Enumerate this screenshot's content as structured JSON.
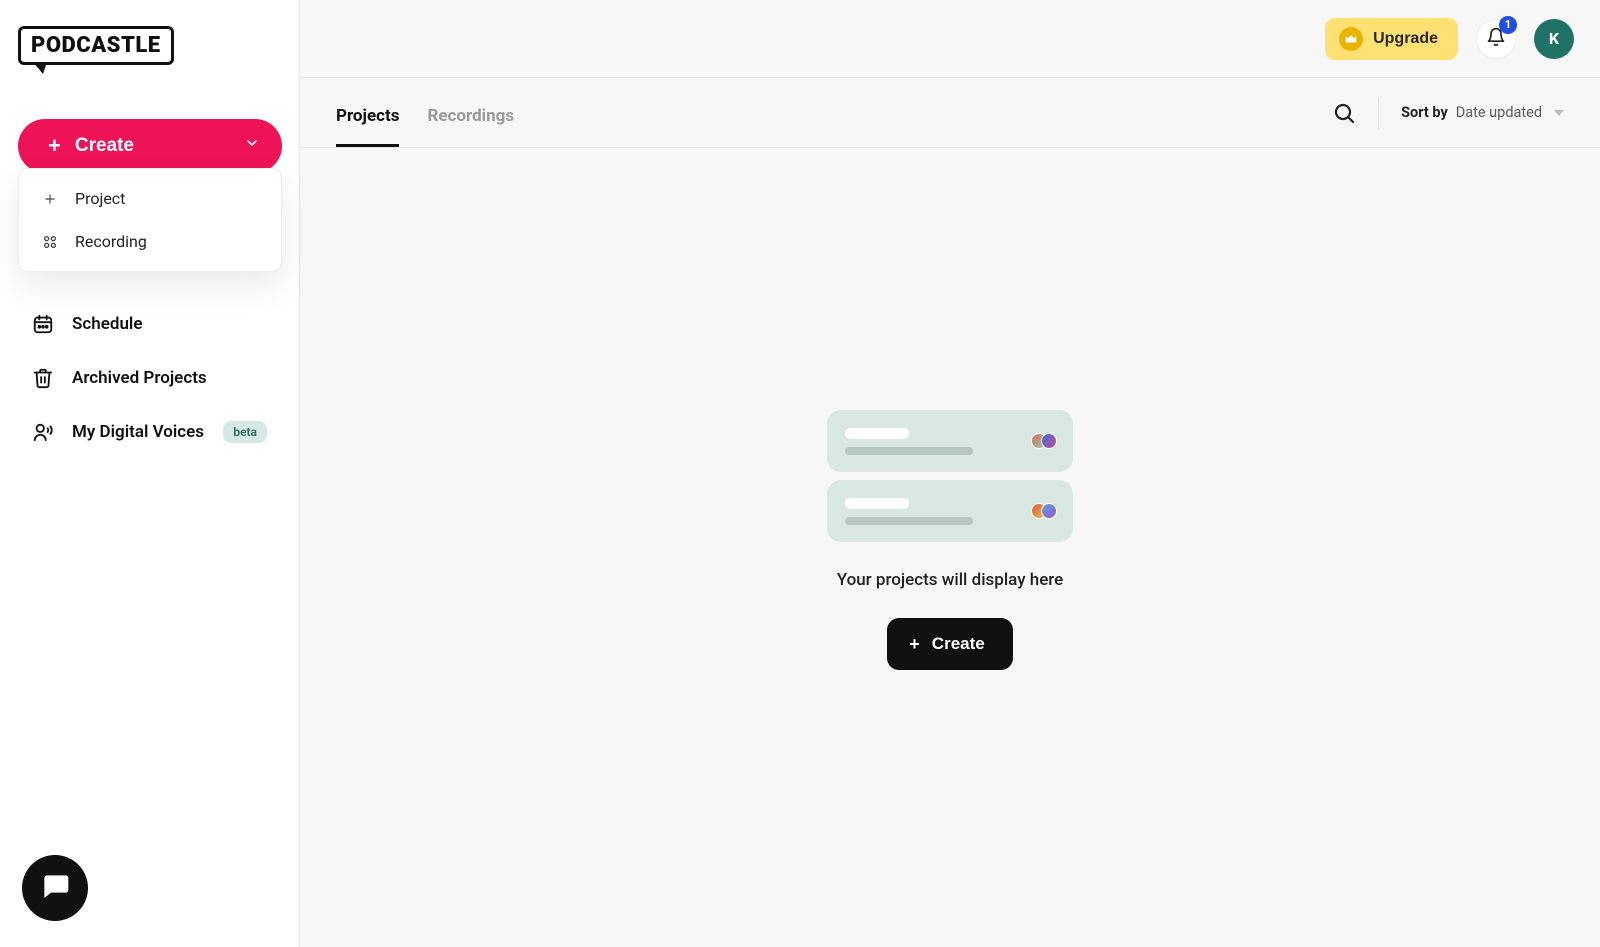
{
  "brand": "PODCASTLE",
  "sidebar": {
    "create_label": "Create",
    "create_menu": {
      "project": "Project",
      "recording": "Recording"
    },
    "nav": {
      "schedule": "Schedule",
      "archived": "Archived Projects",
      "voices": "My Digital Voices",
      "voices_tag": "beta"
    }
  },
  "topbar": {
    "upgrade": "Upgrade",
    "notifications_count": "1",
    "avatar_initial": "K"
  },
  "subheader": {
    "tab_projects": "Projects",
    "tab_recordings": "Recordings",
    "sort_label": "Sort by",
    "sort_value": "Date updated"
  },
  "empty": {
    "message": "Your projects will display here",
    "create": "Create"
  }
}
